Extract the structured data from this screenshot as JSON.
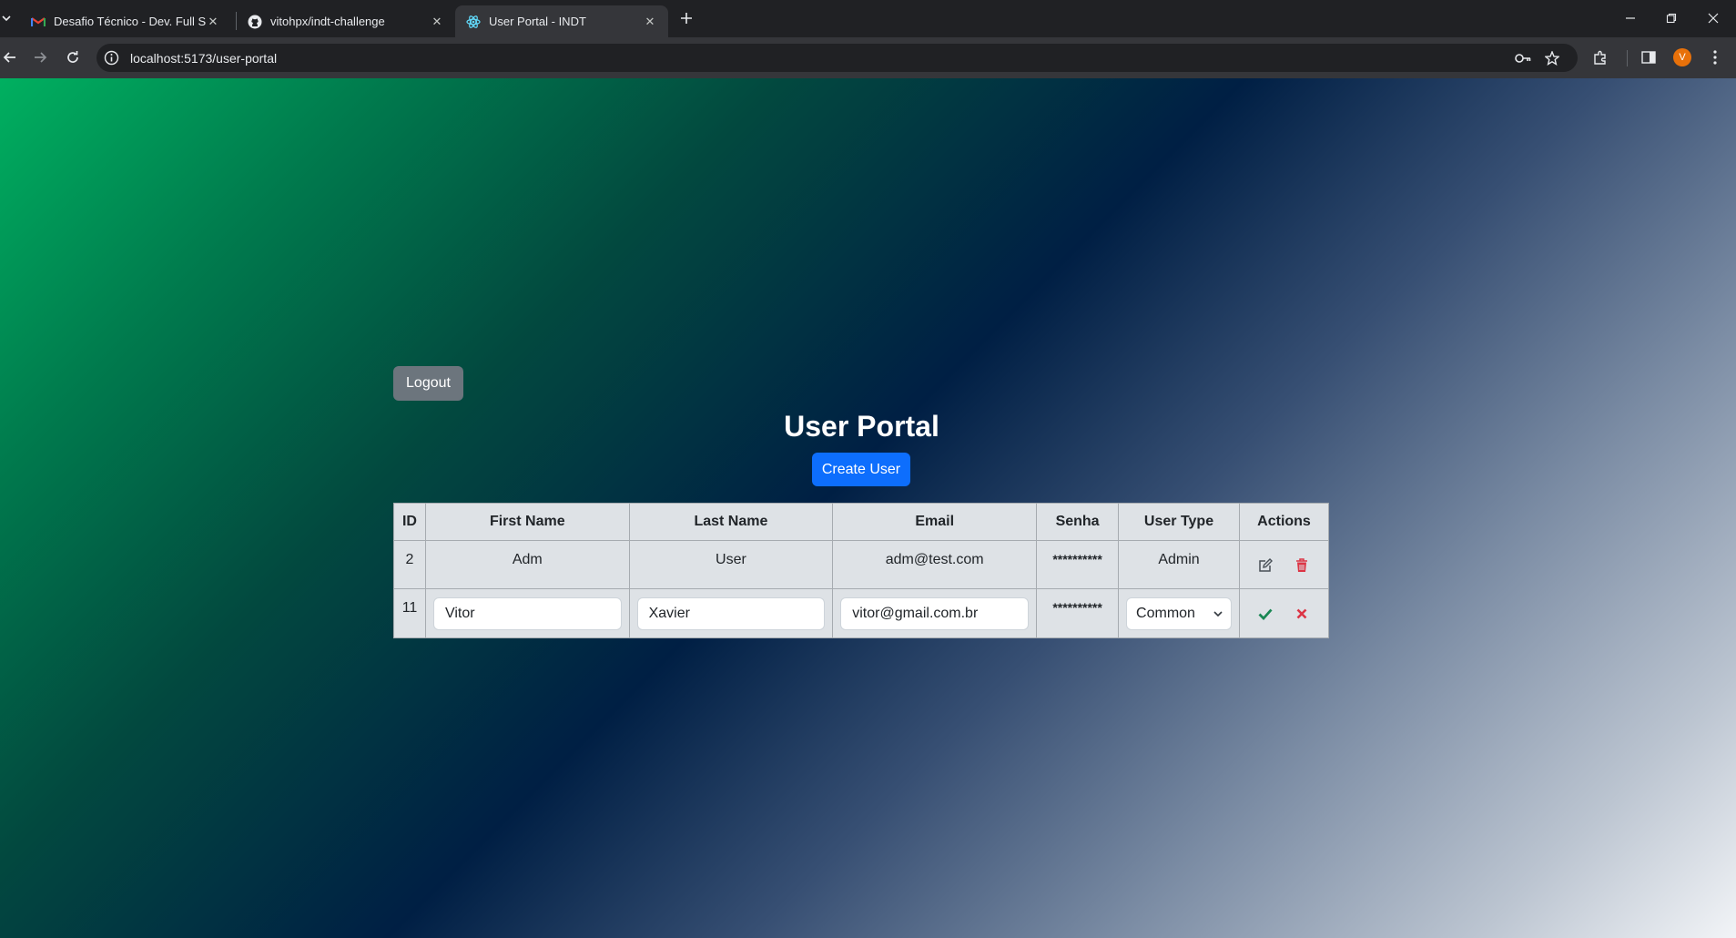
{
  "browser": {
    "tabs": [
      {
        "title": "Desafio Técnico - Dev. Full Stack",
        "icon": "gmail-icon"
      },
      {
        "title": "vitohpx/indt-challenge",
        "icon": "github-icon"
      },
      {
        "title": "User Portal - INDT",
        "icon": "react-icon",
        "active": true
      }
    ],
    "url": "localhost:5173/user-portal",
    "profile_initial": "V"
  },
  "page": {
    "logout_label": "Logout",
    "title": "User Portal",
    "create_label": "Create User"
  },
  "table": {
    "headers": [
      "ID",
      "First Name",
      "Last Name",
      "Email",
      "Senha",
      "User Type",
      "Actions"
    ],
    "rows": [
      {
        "id": "2",
        "first_name": "Adm",
        "last_name": "User",
        "email": "adm@test.com",
        "password": "**********",
        "user_type": "Admin"
      },
      {
        "id": "11",
        "first_name": "Vitor",
        "last_name": "Xavier",
        "email": "vitor@gmail.com.br",
        "password": "**********",
        "user_type": "Common",
        "editing": true
      }
    ]
  },
  "colors": {
    "primary": "#0d6efd",
    "secondary": "#6c757d",
    "danger": "#dc3545",
    "success": "#198754"
  }
}
